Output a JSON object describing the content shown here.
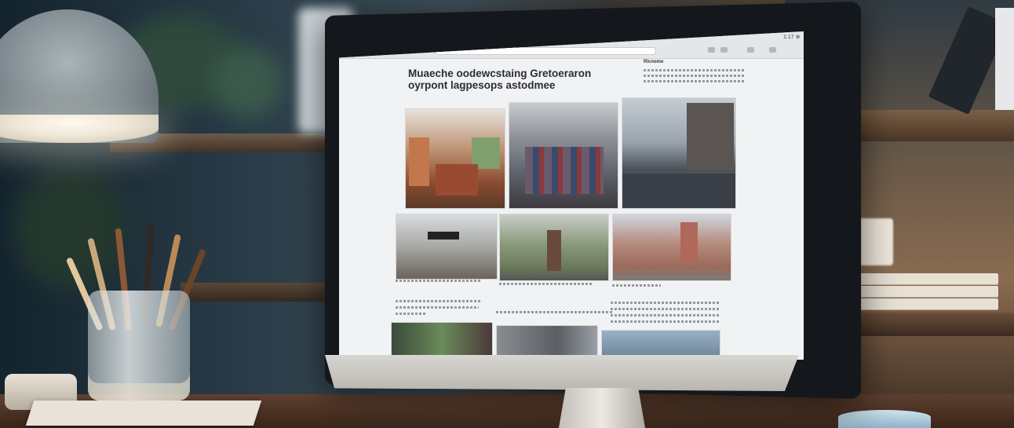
{
  "screen": {
    "corner_label": "1:17 ⊕",
    "url_text": "",
    "headline": "Muaeche oodewcstaing Gretoeraron oyrpont lagpesops astodmee",
    "side_heading": "Rlcnome",
    "captions": [
      "",
      "",
      ""
    ]
  },
  "colors": {
    "screen_bg": "#f1f2f3",
    "bezel": "#14181c",
    "lamp_glow": "#fffaf0",
    "desk": "#5e4030"
  }
}
